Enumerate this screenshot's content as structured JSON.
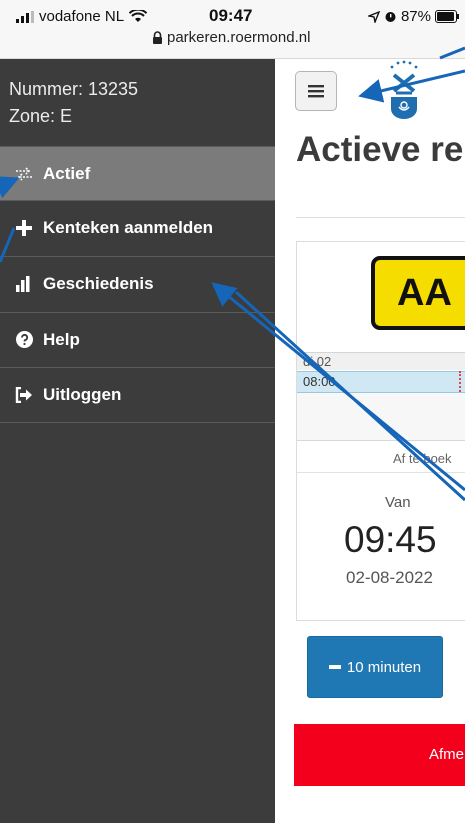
{
  "status_bar": {
    "carrier": "vodafone NL",
    "time": "09:47",
    "battery": "87%",
    "url": "parkeren.roermond.nl"
  },
  "sidebar": {
    "number_label": "Nummer: 13235",
    "zone_label": "Zone: E",
    "items": [
      {
        "label": "Actief",
        "icon": "transfer-arrows-icon",
        "active": true
      },
      {
        "label": "Kenteken aanmelden",
        "icon": "plus-icon",
        "active": false
      },
      {
        "label": "Geschiedenis",
        "icon": "bar-chart-icon",
        "active": false
      },
      {
        "label": "Help",
        "icon": "question-circle-icon",
        "active": false
      },
      {
        "label": "Uitloggen",
        "icon": "logout-icon",
        "active": false
      }
    ]
  },
  "main": {
    "page_title": "Actieve re",
    "plate": "AA",
    "timeline": {
      "date_label": "di 02",
      "time_label": "08:00",
      "book_label": "Af te boek"
    },
    "start": {
      "label": "Van",
      "time": "09:45",
      "date": "02-08-2022"
    },
    "minus_button": "10 minuten",
    "cancel_button": "Afme"
  },
  "colors": {
    "sidebar_bg": "#3c3c3c",
    "active_item_bg": "#7b7b7b",
    "plate_yellow": "#f5dd00",
    "button_blue": "#1f78b4",
    "cancel_red": "#f2001c",
    "annotation_arrow": "#1565b8"
  }
}
